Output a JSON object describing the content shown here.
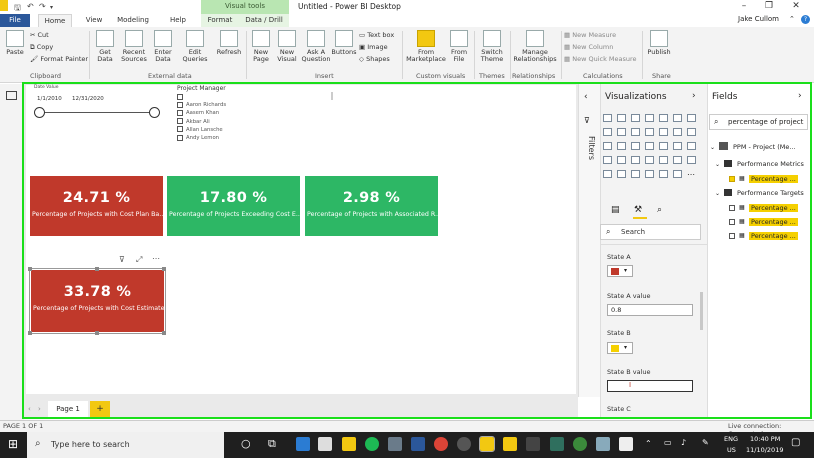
{
  "window": {
    "title": "Untitled - Power BI Desktop",
    "visual_tools": "Visual tools",
    "user": "Jake Cullom"
  },
  "tabs": {
    "file": "File",
    "home": "Home",
    "view": "View",
    "modeling": "Modeling",
    "help": "Help",
    "format": "Format",
    "data_drill": "Data / Drill"
  },
  "ribbon": {
    "paste": "Paste",
    "cut": "Cut",
    "copy": "Copy",
    "format_painter": "Format Painter",
    "get_data": "Get Data",
    "recent_sources": "Recent Sources",
    "enter_data": "Enter Data",
    "edit_queries": "Edit Queries",
    "refresh": "Refresh",
    "new_page": "New Page",
    "new_visual": "New Visual",
    "ask_question": "Ask A Question",
    "buttons": "Buttons",
    "text_box": "Text box",
    "image": "Image",
    "shapes": "Shapes",
    "from_marketplace": "From Marketplace",
    "from_file": "From File",
    "switch_theme": "Switch Theme",
    "manage_relationships": "Manage Relationships",
    "new_measure": "New Measure",
    "new_column": "New Column",
    "new_quick_measure": "New Quick Measure",
    "publish": "Publish",
    "groups": {
      "clipboard": "Clipboard",
      "external_data": "External data",
      "insert": "Insert",
      "custom_visuals": "Custom visuals",
      "themes": "Themes",
      "relationships": "Relationships",
      "calculations": "Calculations",
      "share": "Share"
    }
  },
  "slicer": {
    "title": "Date Value",
    "start": "1/1/2010",
    "end": "12/31/2020"
  },
  "pm_slicer": {
    "title": "Project Manager",
    "items": [
      "",
      "Aaron Richards",
      "Aasem Khan",
      "Akbar Ali",
      "Allan Lansche",
      "Andy Lemon"
    ]
  },
  "cards": [
    {
      "value": "24.71 %",
      "label": "Percentage of Projects with Cost Plan Ba..."
    },
    {
      "value": "17.80 %",
      "label": "Percentage of Projects Exceeding Cost E..."
    },
    {
      "value": "2.98 %",
      "label": "Percentage of Projects with Associated R..."
    },
    {
      "value": "33.78 %",
      "label": "Percentage of Projects with Cost Estimate"
    }
  ],
  "colors": {
    "red": "#c0392b",
    "green": "#2db765",
    "highlight": "#f5d000",
    "border": "#1adf1a",
    "state_a": "#c0392b",
    "state_b": "#f5d000"
  },
  "filters": {
    "label": "Filters"
  },
  "visualizations": {
    "title": "Visualizations",
    "search_placeholder": "Search",
    "state_a": "State A",
    "state_a_value_label": "State A value",
    "state_a_value": "0.8",
    "state_b": "State B",
    "state_b_value_label": "State B value",
    "state_b_value": "",
    "state_c": "State C"
  },
  "fields": {
    "title": "Fields",
    "search_value": "percentage of project",
    "table": "PPM - Project (Me...",
    "perf_metrics": "Performance Metrics",
    "perf_targets": "Performance Targets",
    "field_item": "Percentage ..."
  },
  "page_tabs": {
    "page1": "Page 1",
    "add": "+"
  },
  "status": {
    "left": "PAGE 1 OF 1",
    "right": "Live connection: Connected"
  },
  "taskbar": {
    "search": "Type here to search",
    "lang1": "ENG",
    "lang2": "US",
    "time": "10:40 PM",
    "date": "11/10/2019"
  }
}
